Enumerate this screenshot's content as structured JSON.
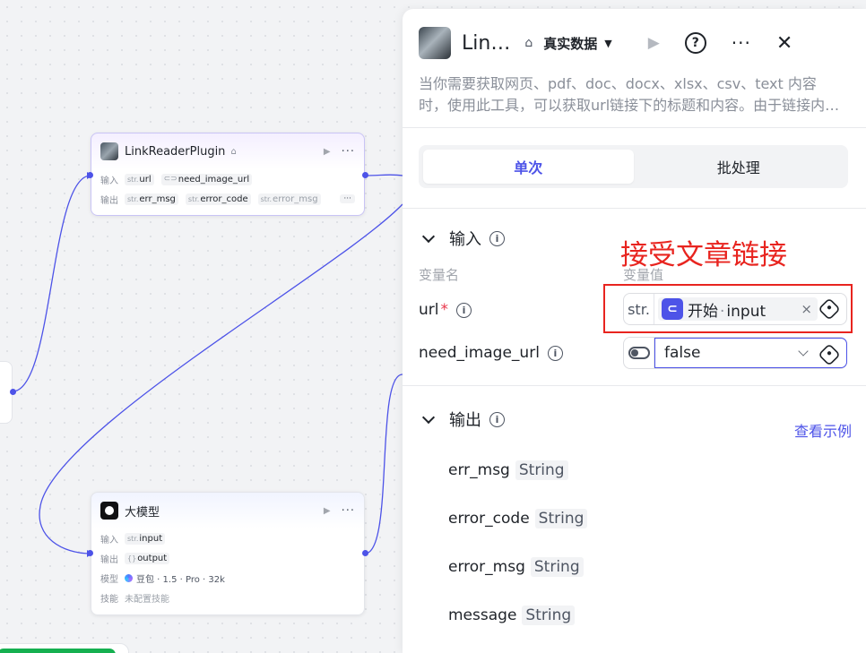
{
  "canvas": {
    "plugin_node": {
      "title": "LinkReaderPlugin",
      "inputs_label": "输入",
      "outputs_label": "输出",
      "inputs": [
        {
          "type": "str.",
          "name": "url"
        },
        {
          "type": "",
          "name": "need_image_url"
        }
      ],
      "outputs": [
        {
          "type": "str.",
          "name": "err_msg"
        },
        {
          "type": "str.",
          "name": "error_code"
        },
        {
          "type": "str.",
          "name": "error_msg"
        }
      ],
      "more": "···"
    },
    "llm_node": {
      "title": "大模型",
      "input_label": "输入",
      "input_type": "str.",
      "input_name": "input",
      "output_label": "输出",
      "output_type": "{}",
      "output_name": "output",
      "model_label": "模型",
      "model_value": "豆包 · 1.5 · Pro · 32k",
      "skill_label": "技能",
      "skill_value": "未配置技能"
    }
  },
  "panel": {
    "title": "Lin…",
    "mode": "真实数据",
    "description": "当你需要获取网页、pdf、doc、docx、xlsx、csv、text 内容时，使用此工具，可以获取url链接下的标题和内容。由于链接内容可能较多，请按需获取。",
    "tabs": [
      "单次",
      "批处理"
    ],
    "input_section": {
      "title": "输入",
      "col_name": "变量名",
      "col_value": "变量值",
      "params": [
        {
          "name": "url",
          "required": "*",
          "type": "str.",
          "ref_node": "开始",
          "ref_sep": "·",
          "ref_var": "input"
        },
        {
          "name": "need_image_url",
          "value": "false"
        }
      ]
    },
    "output_section": {
      "title": "输出",
      "example_link": "查看示例",
      "fields": [
        {
          "name": "err_msg",
          "type": "String"
        },
        {
          "name": "error_code",
          "type": "String"
        },
        {
          "name": "error_msg",
          "type": "String"
        },
        {
          "name": "message",
          "type": "String"
        }
      ]
    }
  },
  "annotation": {
    "text": "接受文章链接",
    "color": "#e8241f"
  },
  "colors": {
    "accent": "#4d53e8",
    "required": "#e8354a"
  }
}
